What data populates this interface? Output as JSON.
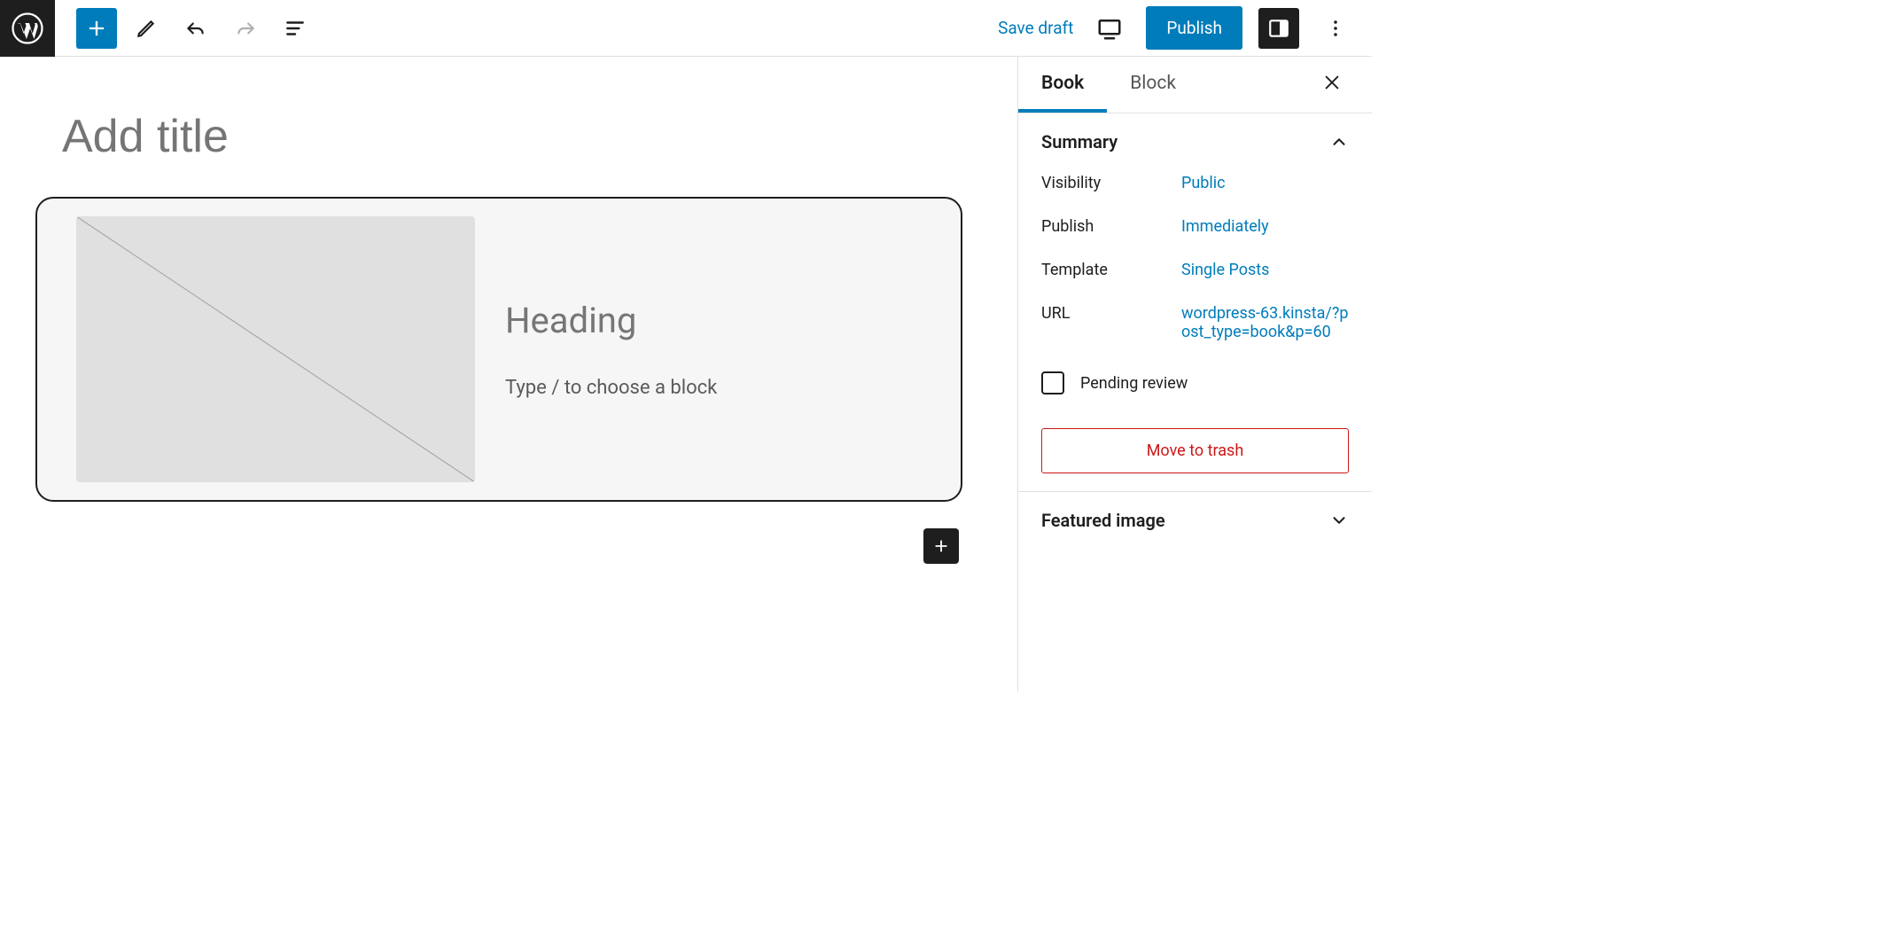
{
  "toolbar": {
    "save_draft": "Save draft",
    "publish": "Publish"
  },
  "editor": {
    "title_placeholder": "Add title",
    "block": {
      "heading": "Heading",
      "slash_text": "Type / to choose a block"
    }
  },
  "sidebar": {
    "tabs": {
      "book": "Book",
      "block": "Block"
    },
    "summary": {
      "title": "Summary",
      "visibility_label": "Visibility",
      "visibility_value": "Public",
      "publish_label": "Publish",
      "publish_value": "Immediately",
      "template_label": "Template",
      "template_value": "Single Posts",
      "url_label": "URL",
      "url_value": "wordpress-63.kinsta/?post_type=book&p=60",
      "pending_review": "Pending review",
      "move_to_trash": "Move to trash"
    },
    "featured_image": {
      "title": "Featured image"
    }
  }
}
